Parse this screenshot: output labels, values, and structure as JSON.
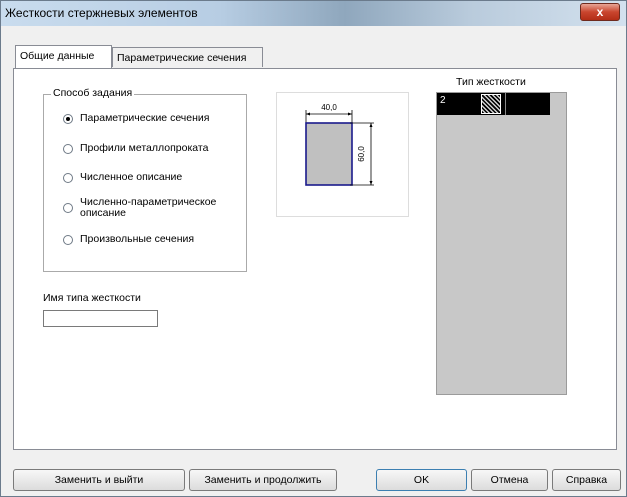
{
  "window": {
    "title": "Жесткости стержневых элементов",
    "close_label": "x"
  },
  "tabs": [
    {
      "label": "Общие данные",
      "active": true
    },
    {
      "label": "Параметрические сечения",
      "active": false
    }
  ],
  "method_group": {
    "legend": "Способ задания",
    "options": [
      {
        "label": "Параметрические сечения",
        "checked": true
      },
      {
        "label": "Профили металлопроката",
        "checked": false
      },
      {
        "label": "Численное описание",
        "checked": false
      },
      {
        "label": "Численно-параметрическое описание",
        "checked": false
      },
      {
        "label": "Произвольные сечения",
        "checked": false
      }
    ]
  },
  "preview": {
    "width_label": "40,0",
    "height_label": "60,0",
    "fill_color": "#c0c0c0",
    "outline_color": "#1a1a8c"
  },
  "stiffness_name": {
    "label": "Имя типа жесткости",
    "value": ""
  },
  "stiffness_types": {
    "header": "Тип жесткости",
    "rows": [
      {
        "number": "2",
        "pattern": "hatch-icon"
      }
    ]
  },
  "buttons": {
    "replace_exit": "Заменить и выйти",
    "replace_continue": "Заменить и продолжить",
    "ok": "OK",
    "cancel": "Отмена",
    "help": "Справка"
  },
  "colors": {
    "list_bg": "#c8c8c8",
    "selected_row": "#000000",
    "close_button": "#c9452e"
  }
}
